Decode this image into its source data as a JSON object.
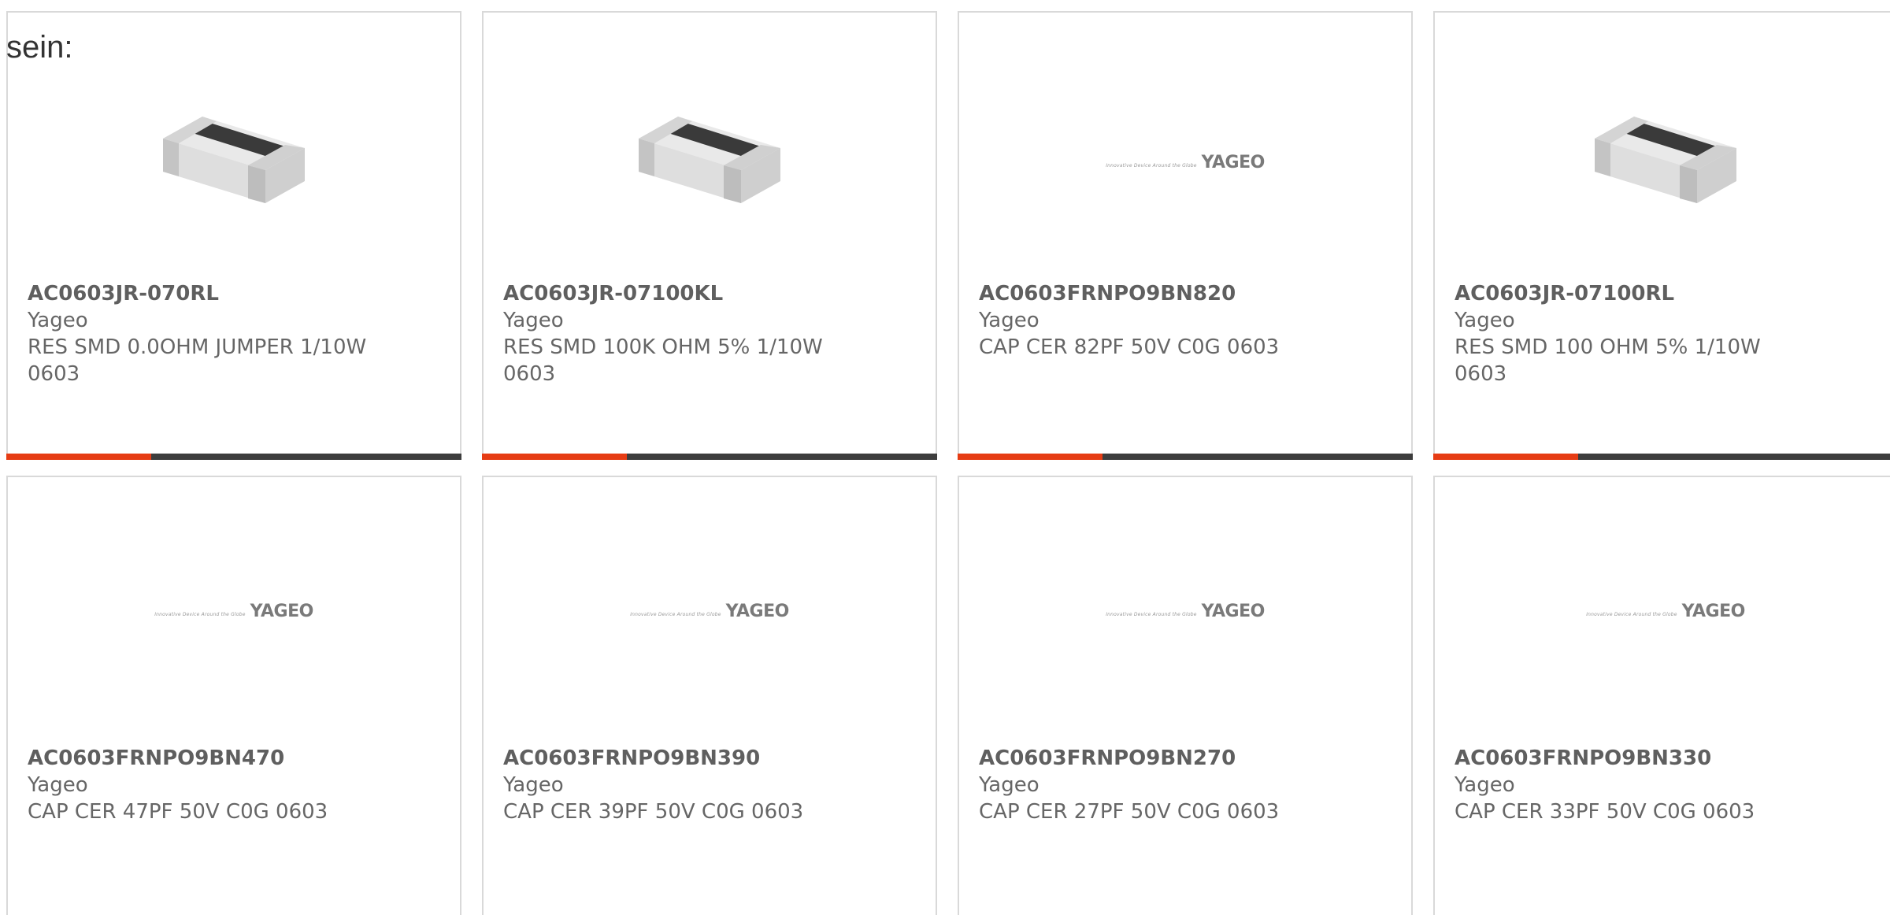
{
  "intro_text": "sein:",
  "colors": {
    "accent": "#e63c14",
    "bar_dark": "#3d3d3d",
    "border": "#d9d9d9",
    "text": "#666666"
  },
  "logo": {
    "tagline": "Innovative Device Around the Globe",
    "wordmark": "YAGEO"
  },
  "products": [
    {
      "part_number": "AC0603JR-070RL",
      "manufacturer": "Yageo",
      "description": "RES SMD 0.0OHM JUMPER 1/10W 0603",
      "image": "resistor-chip"
    },
    {
      "part_number": "AC0603JR-07100KL",
      "manufacturer": "Yageo",
      "description": "RES SMD 100K OHM 5% 1/10W 0603",
      "image": "resistor-chip"
    },
    {
      "part_number": "AC0603FRNPO9BN820",
      "manufacturer": "Yageo",
      "description": "CAP CER 82PF 50V C0G 0603",
      "image": "yageo-logo"
    },
    {
      "part_number": "AC0603JR-07100RL",
      "manufacturer": "Yageo",
      "description": "RES SMD 100 OHM 5% 1/10W 0603",
      "image": "resistor-chip"
    },
    {
      "part_number": "AC0603FRNPO9BN470",
      "manufacturer": "Yageo",
      "description": "CAP CER 47PF 50V C0G 0603",
      "image": "yageo-logo"
    },
    {
      "part_number": "AC0603FRNPO9BN390",
      "manufacturer": "Yageo",
      "description": "CAP CER 39PF 50V C0G 0603",
      "image": "yageo-logo"
    },
    {
      "part_number": "AC0603FRNPO9BN270",
      "manufacturer": "Yageo",
      "description": "CAP CER 27PF 50V C0G 0603",
      "image": "yageo-logo"
    },
    {
      "part_number": "AC0603FRNPO9BN330",
      "manufacturer": "Yageo",
      "description": "CAP CER 33PF 50V C0G 0603",
      "image": "yageo-logo"
    }
  ]
}
